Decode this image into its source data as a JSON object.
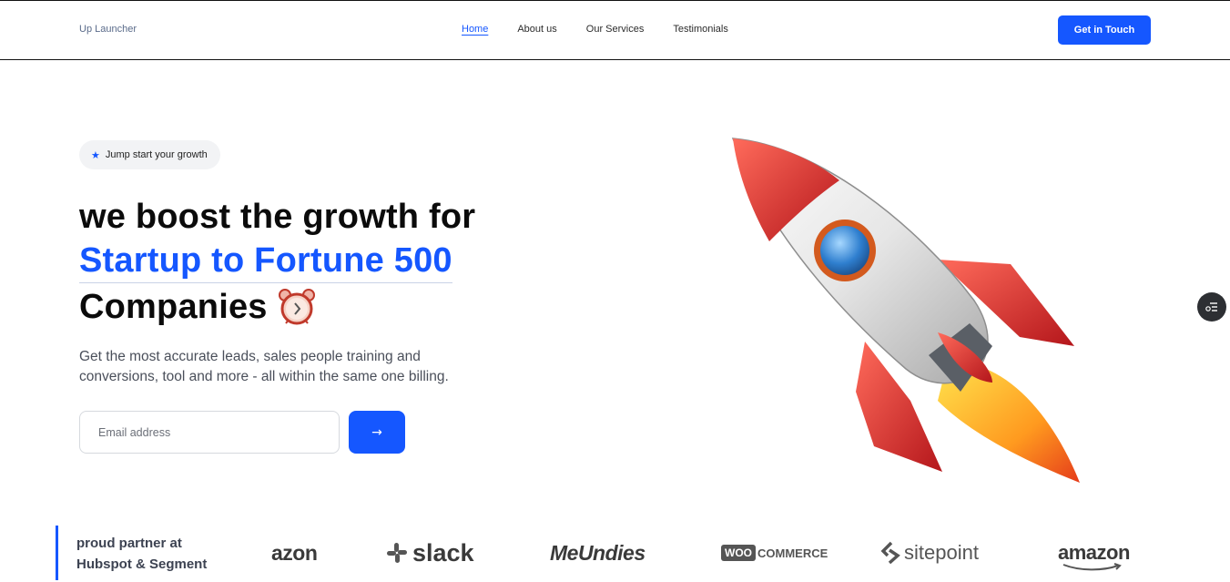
{
  "header": {
    "brand": "Up Launcher",
    "nav": [
      {
        "label": "Home",
        "active": true
      },
      {
        "label": "About us",
        "active": false
      },
      {
        "label": "Our Services",
        "active": false
      },
      {
        "label": "Testimonials",
        "active": false
      }
    ],
    "cta_label": "Get in Touch"
  },
  "hero": {
    "badge_icon": "star-icon",
    "badge_text": "Jump start your growth",
    "headline_line1": "we boost the growth for",
    "headline_line2": "Startup to Fortune 500",
    "headline_line3": "Companies",
    "headline_icon": "alarm-clock-icon",
    "subtitle": "Get the most accurate leads, sales people training and conversions, tool and more - all within the same one billing.",
    "email_placeholder": "Email address",
    "submit_label": "→",
    "illustration": "rocket-illustration"
  },
  "partners": {
    "line1": "proud partner at",
    "line2": "Hubspot & Segment",
    "logos": [
      "amazon",
      "slack",
      "MeUndies",
      "WOO COMMERCE",
      "sitepoint",
      "amazon"
    ],
    "logo_text": {
      "amazon_partial": "azon",
      "slack": "slack",
      "meundies": "MeUndies",
      "woo": "WOO",
      "commerce": "COMMERCE",
      "sitepoint": "sitepoint",
      "amazon": "amazon"
    }
  },
  "colors": {
    "accent": "#1557ff",
    "text": "#0b0b0b",
    "muted": "#4a4f5a"
  }
}
